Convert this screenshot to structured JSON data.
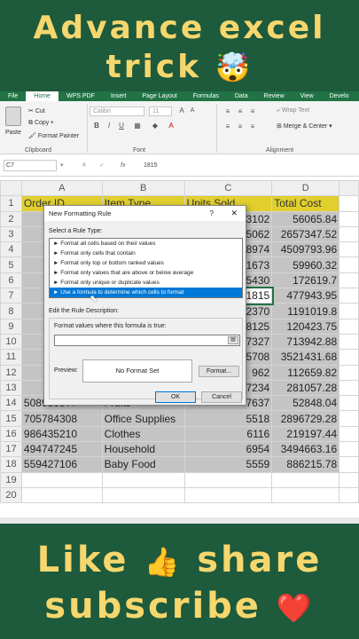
{
  "banner_top": {
    "line1": "Advance excel",
    "line2": "trick",
    "emoji": "🤯"
  },
  "banner_bottom": {
    "line1_a": "Like",
    "thumb": "👍",
    "line1_b": "share",
    "line2": "subscribe",
    "heart": "❤️"
  },
  "menu": [
    "File",
    "Home",
    "WPS PDF",
    "Insert",
    "Page Layout",
    "Formulas",
    "Data",
    "Review",
    "View",
    "Develo"
  ],
  "ribbon": {
    "paste": "Paste",
    "cut": "Cut",
    "copy": "Copy ▾",
    "format_painter": "Format Painter",
    "clipboard": "Clipboard",
    "font_name": "Calibri",
    "font_size": "11",
    "font": "Font",
    "wrap_text": "Wrap Text",
    "merge_center": "Merge & Center ▾",
    "alignment": "Alignment"
  },
  "formula_bar": {
    "name_box": "C7",
    "fx": "fx",
    "value": "1815"
  },
  "columns": [
    "A",
    "B",
    "C",
    "D"
  ],
  "header_row": [
    "Order ID",
    "Item Type",
    "Units Sold",
    "Total Cost"
  ],
  "rows": [
    [
      "",
      "",
      "3102",
      "56065.84"
    ],
    [
      "",
      "",
      "5062",
      "2657347.52"
    ],
    [
      "",
      "",
      "8974",
      "4509793.96"
    ],
    [
      "",
      "",
      "1673",
      "59960.32"
    ],
    [
      "",
      "",
      "5430",
      "172619.7"
    ],
    [
      "",
      "",
      "1815",
      "477943.95"
    ],
    [
      "",
      "",
      "2370",
      "1191019.8"
    ],
    [
      "",
      "",
      "8125",
      "120423.75"
    ],
    [
      "",
      "",
      "7327",
      "713942.88"
    ],
    [
      "",
      "",
      "5708",
      "3521431.68"
    ],
    [
      "",
      "",
      "962",
      "112659.82"
    ],
    [
      "",
      "",
      "7234",
      "281057.28"
    ],
    [
      "508980977",
      "Fruits",
      "7637",
      "52848.04"
    ],
    [
      "705784308",
      "Office Supplies",
      "5518",
      "2896729.28"
    ],
    [
      "986435210",
      "Clothes",
      "6116",
      "219197.44"
    ],
    [
      "494747245",
      "Household",
      "6954",
      "3494663.16"
    ],
    [
      "559427106",
      "Baby Food",
      "5559",
      "886215.78"
    ]
  ],
  "row_numbers": [
    "1",
    "2",
    "3",
    "4",
    "5",
    "6",
    "7",
    "8",
    "9",
    "10",
    "11",
    "12",
    "13",
    "14",
    "15",
    "16",
    "17",
    "18",
    "19",
    "20"
  ],
  "dialog": {
    "title": "New Formatting Rule",
    "help": "?",
    "close": "✕",
    "select_label": "Select a Rule Type:",
    "rules": [
      "► Format all cells based on their values",
      "► Format only cells that contain",
      "► Format only top or bottom ranked values",
      "► Format only values that are above or below average",
      "► Format only unique or duplicate values",
      "► Use a formula to determine which cells to format"
    ],
    "edit_label": "Edit the Rule Description:",
    "formula_label": "Format values where this formula is true:",
    "preview_label": "Preview:",
    "preview_text": "No Format Set",
    "format_button": "Format...",
    "ok": "OK",
    "cancel": "Cancel"
  }
}
